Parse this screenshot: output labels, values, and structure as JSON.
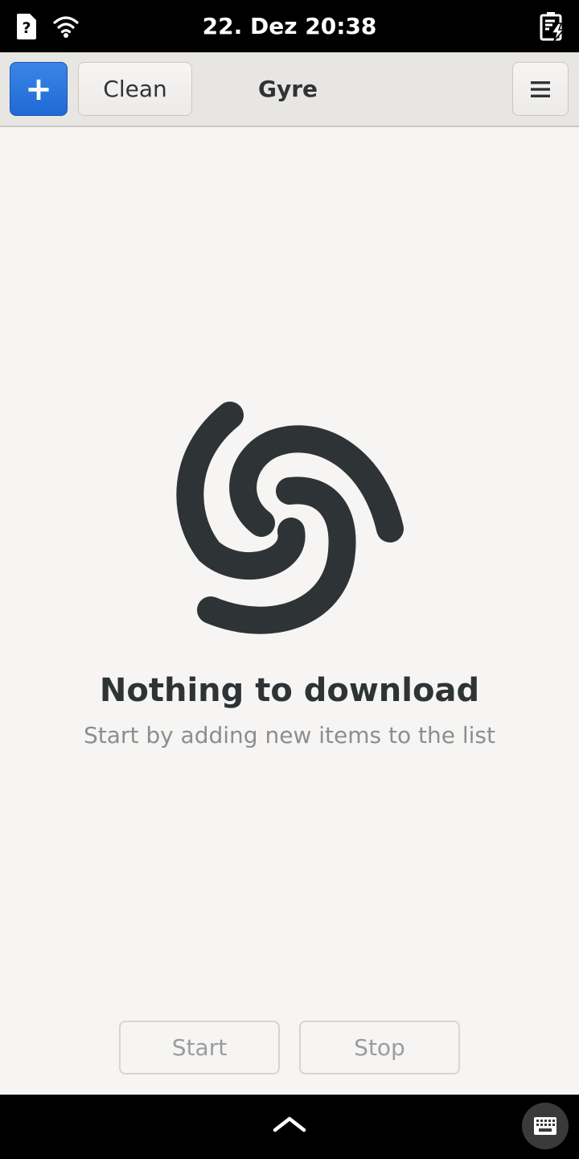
{
  "status_bar": {
    "clock": "22. Dez  20:38",
    "icons": [
      "sim-unknown-icon",
      "wifi-icon",
      "battery-charging-icon"
    ]
  },
  "header": {
    "add_label": "+",
    "clean_label": "Clean",
    "title": "Gyre",
    "menu_icon": "hamburger-menu-icon",
    "accent_color": "#2a76dd"
  },
  "empty_state": {
    "icon": "gyre-spiral-icon",
    "title": "Nothing to download",
    "subtitle": "Start by adding new items to the list"
  },
  "actions": {
    "start_label": "Start",
    "stop_label": "Stop"
  },
  "bottom_bar": {
    "icons": [
      "chevron-up-icon",
      "keyboard-icon"
    ]
  }
}
